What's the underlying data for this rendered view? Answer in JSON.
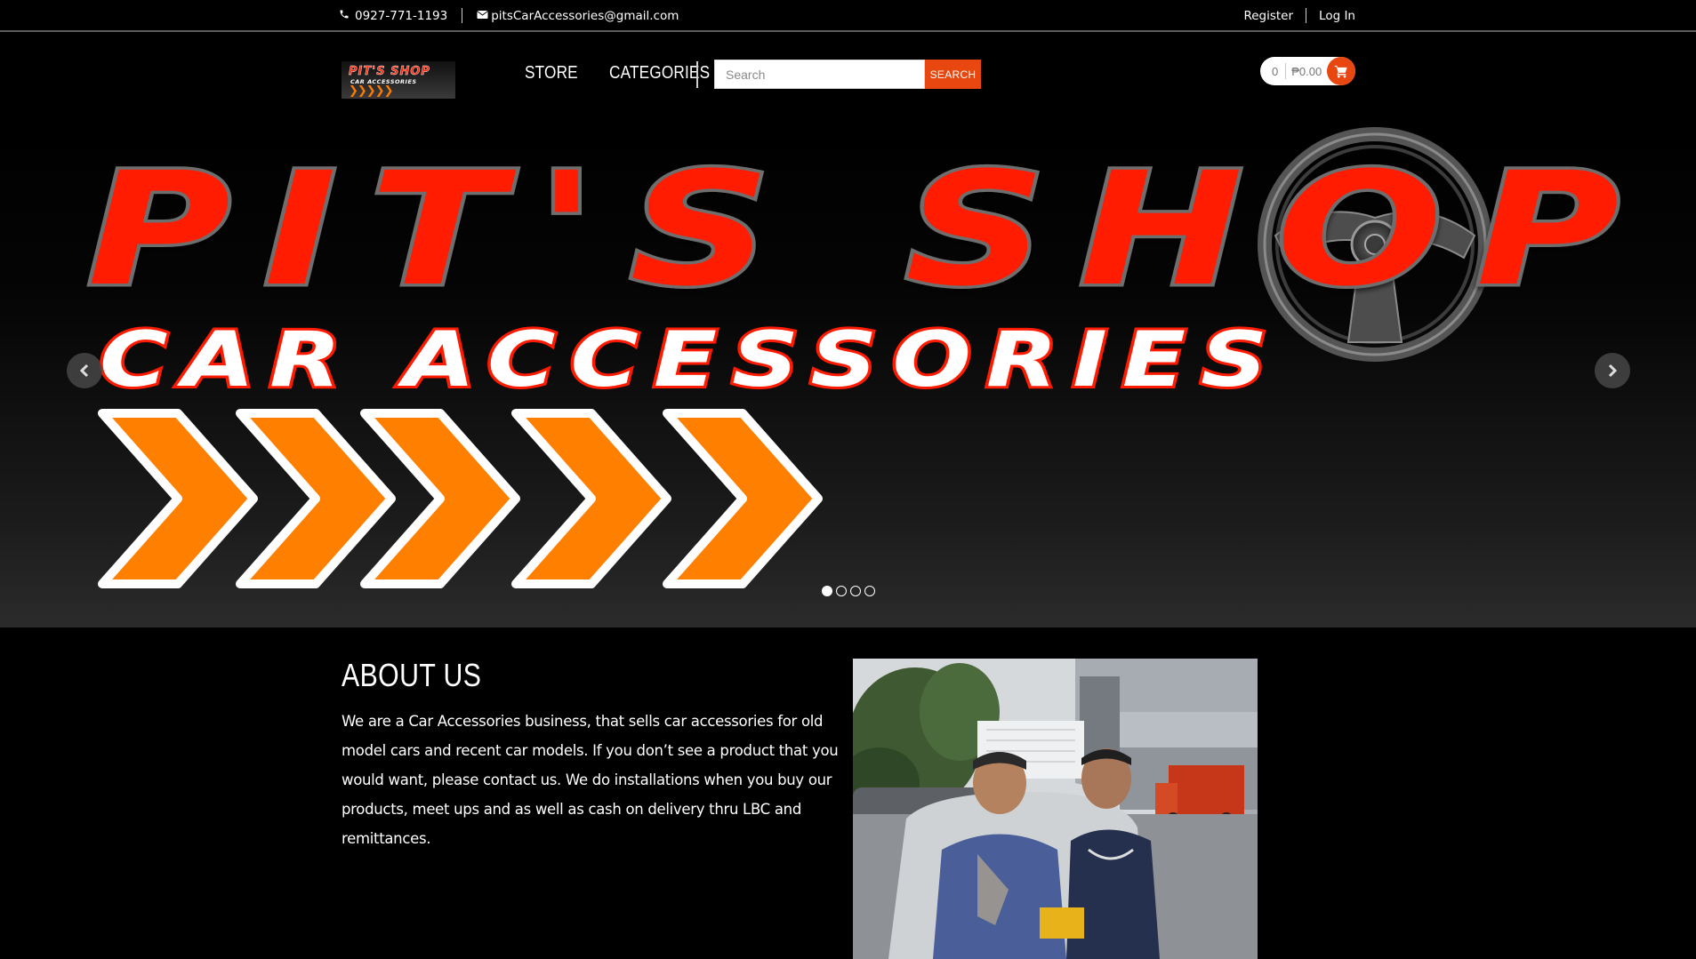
{
  "topbar": {
    "phone": "0927-771-1193",
    "email": "pitsCarAccessories@gmail.com",
    "register": "Register",
    "login": "Log In"
  },
  "header": {
    "logo": {
      "line1": "PIT'S SHOP",
      "line2": "CAR ACCESSORIES",
      "line3": "❯❯❯❯❯"
    },
    "nav": [
      {
        "label": "STORE"
      },
      {
        "label": "CATEGORIES"
      }
    ],
    "search": {
      "placeholder": "Search",
      "button": "SEARCH"
    },
    "cart": {
      "count": "0",
      "total": "₱0.00"
    }
  },
  "hero": {
    "title": "PIT'S SHOP",
    "subtitle": "CAR ACCESSORIES",
    "slides": 4,
    "active_slide": 1
  },
  "about": {
    "heading": "ABOUT US",
    "body": "We are a Car Accessories business, that sells car accessories for old model cars and recent car models. If you don’t see a product that you would want, please contact us. We do installations when you buy our products, meet ups and as well as cash on delivery thru LBC and remittances."
  },
  "colors": {
    "accent": "#e8470f",
    "logo_red": "#ff1a00",
    "logo_orange": "#ff7f00",
    "background": "#000000"
  },
  "icons": {
    "phone": "phone-icon",
    "email": "envelope-icon",
    "cart": "shopping-cart-icon",
    "prev": "chevron-left-icon",
    "next": "chevron-right-icon"
  }
}
